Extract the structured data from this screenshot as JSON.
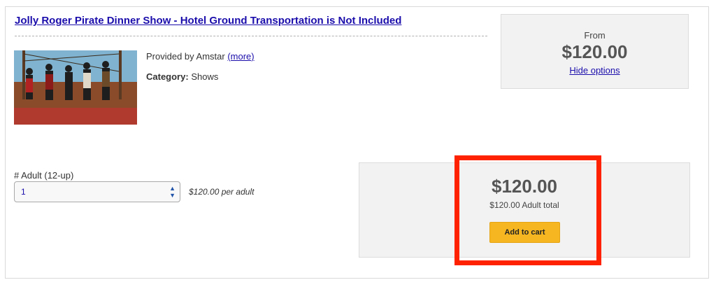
{
  "product": {
    "title": "Jolly Roger Pirate Dinner Show - Hotel Ground Transportation is Not Included",
    "provided_by": "Provided by Amstar",
    "more_link": "(more)",
    "category_label": "Category:",
    "category_value": "Shows"
  },
  "price_box": {
    "from_label": "From",
    "price": "$120.00",
    "hide_options": "Hide options"
  },
  "booking": {
    "qty_label": "# Adult (12-up)",
    "qty_value": "1",
    "per_adult": "$120.00 per adult",
    "total_price": "$120.00",
    "total_sub": "$120.00 Adult total",
    "add_to_cart": "Add to cart"
  },
  "colors": {
    "link": "#1a0dab",
    "button": "#f6b621",
    "highlight": "#ff2200"
  }
}
